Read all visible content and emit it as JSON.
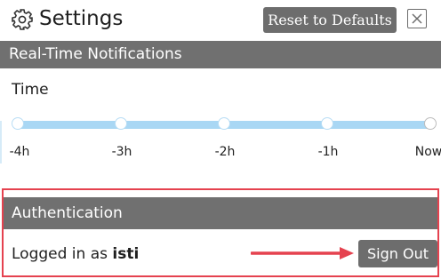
{
  "header": {
    "title": "Settings",
    "reset_label": "Reset to Defaults",
    "close_icon": "close-icon",
    "settings_icon": "gear-icon"
  },
  "realtime": {
    "section_title": "Real-Time Notifications",
    "time_label": "Time",
    "ticks": [
      "-4h",
      "-3h",
      "-2h",
      "-1h",
      "Now"
    ]
  },
  "auth": {
    "section_title": "Authentication",
    "logged_in_prefix": "Logged in as",
    "username": "isti",
    "sign_out_label": "Sign Out"
  },
  "colors": {
    "section_bar": "#707070",
    "button": "#6d6d6d",
    "slider_track": "#a9d7f4",
    "highlight_border": "#e5424f"
  }
}
